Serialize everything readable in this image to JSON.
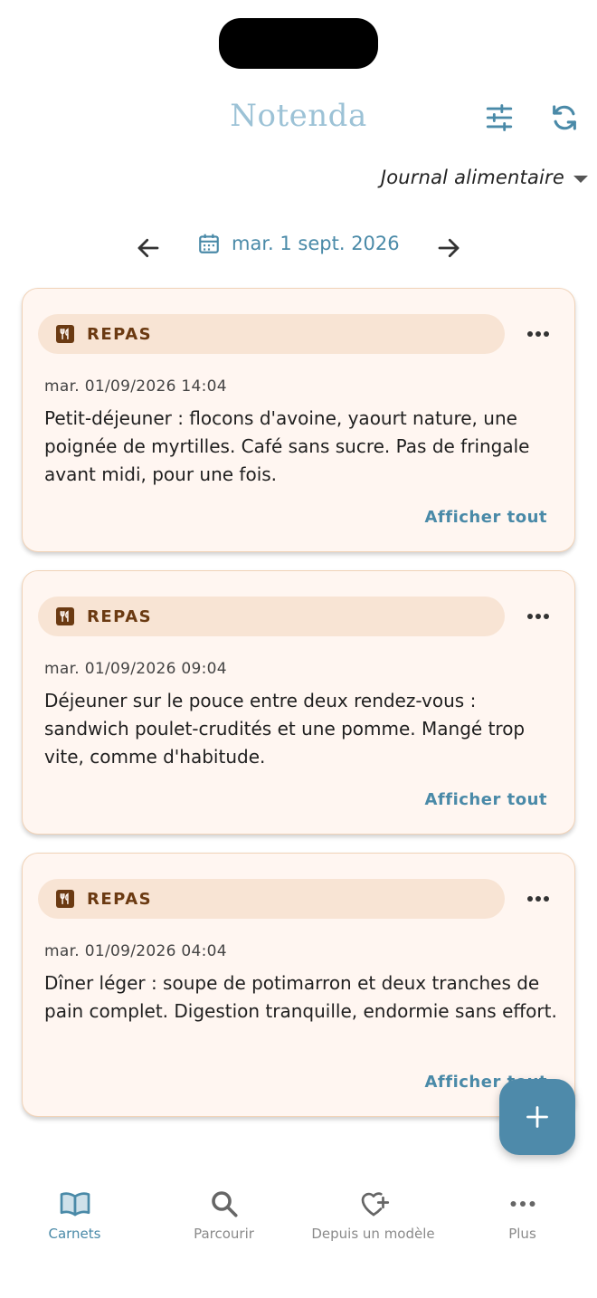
{
  "header": {
    "app_title": "Notenda",
    "journal_selector": "Journal alimentaire"
  },
  "date_nav": {
    "current_date": "mar. 1 sept. 2026"
  },
  "entries": [
    {
      "category": "REPAS",
      "timestamp": "mar. 01/09/2026 14:04",
      "text": "Petit-déjeuner : flocons d'avoine, yaourt nature, une poignée de myrtilles. Café sans sucre. Pas de fringale avant midi, pour une fois.",
      "show_all": "Afficher tout"
    },
    {
      "category": "REPAS",
      "timestamp": "mar. 01/09/2026 09:04",
      "text": "Déjeuner sur le pouce entre deux rendez-vous : sandwich poulet-crudités et une pomme. Mangé trop vite, comme d'habitude.",
      "show_all": "Afficher tout"
    },
    {
      "category": "REPAS",
      "timestamp": "mar. 01/09/2026 04:04",
      "text": "Dîner léger : soupe de potimarron et deux tranches de pain complet. Digestion tranquille, endormie sans effort.",
      "show_all": "Afficher tout"
    }
  ],
  "bottom_nav": {
    "items": [
      {
        "label": "Carnets",
        "icon": "book-open-icon",
        "active": true
      },
      {
        "label": "Parcourir",
        "icon": "search-icon",
        "active": false
      },
      {
        "label": "Depuis un modèle",
        "icon": "heart-plus-icon",
        "active": false
      },
      {
        "label": "Plus",
        "icon": "more-horizontal-icon",
        "active": false
      }
    ]
  },
  "colors": {
    "accent": "#4a8aa8",
    "title": "#9cc2d6",
    "card_bg": "#fff6f1",
    "card_border": "#f1d3b8",
    "tag_bg": "#f8e4d4",
    "tag_text": "#6b3a12",
    "fab": "#4e8aaa"
  }
}
